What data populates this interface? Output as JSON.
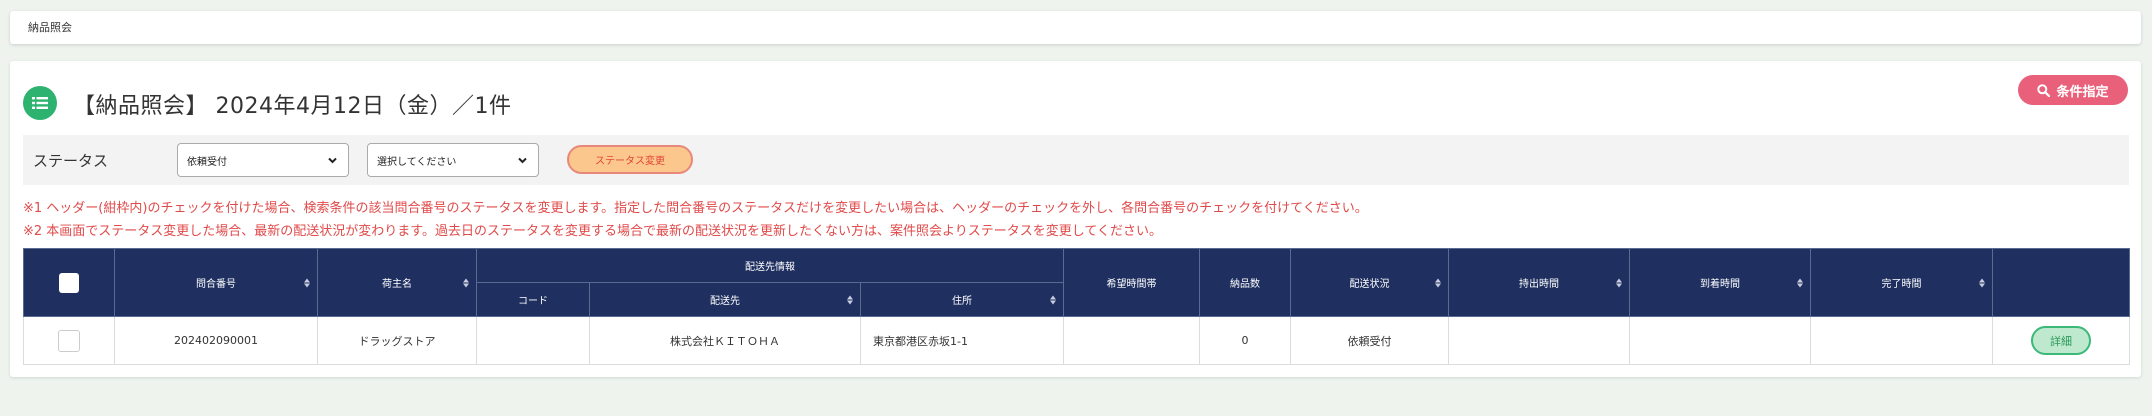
{
  "breadcrumb": {
    "label": "納品照会"
  },
  "page": {
    "title": "【納品照会】 2024年4月12日（金）／1件",
    "condition_button": "条件指定"
  },
  "status_bar": {
    "label": "ステータス",
    "select1": {
      "value": "依頼受付"
    },
    "select2": {
      "value": "選択してください"
    },
    "change_button": "ステータス変更"
  },
  "notes": [
    "※1 ヘッダー(紺枠内)のチェックを付けた場合、検索条件の該当問合番号のステータスを変更します。指定した問合番号のステータスだけを変更したい場合は、ヘッダーのチェックを外し、各問合番号のチェックを付けてください。",
    "※2 本画面でステータス変更した場合、最新の配送状況が変わります。過去日のステータスを変更する場合で最新の配送状況を更新したくない方は、案件照会よりステータスを変更してください。"
  ],
  "table": {
    "headers": {
      "inquiry_no": "問合番号",
      "shipper": "荷主名",
      "delivery_info": "配送先情報",
      "code": "コード",
      "destination": "配送先",
      "address": "住所",
      "desired_time": "希望時間帯",
      "quantity": "納品数",
      "delivery_status": "配送状況",
      "pickup_time": "持出時間",
      "arrival_time": "到着時間",
      "completion_time": "完了時間"
    },
    "rows": [
      {
        "inquiry_no": "202402090001",
        "shipper": "ドラッグストア",
        "code": "",
        "destination": "株式会社ＫＩＴＯＨＡ",
        "address": "東京都港区赤坂1-1",
        "desired_time": "",
        "quantity": "0",
        "delivery_status": "依頼受付",
        "pickup_time": "",
        "arrival_time": "",
        "completion_time": "",
        "detail_button": "詳細"
      }
    ]
  },
  "colors": {
    "header_bg": "#1f3060",
    "accent_green": "#2db36f",
    "condition_pink": "#e8607a",
    "note_red": "#e04a4a",
    "status_btn_orange": "#fcc78d"
  }
}
